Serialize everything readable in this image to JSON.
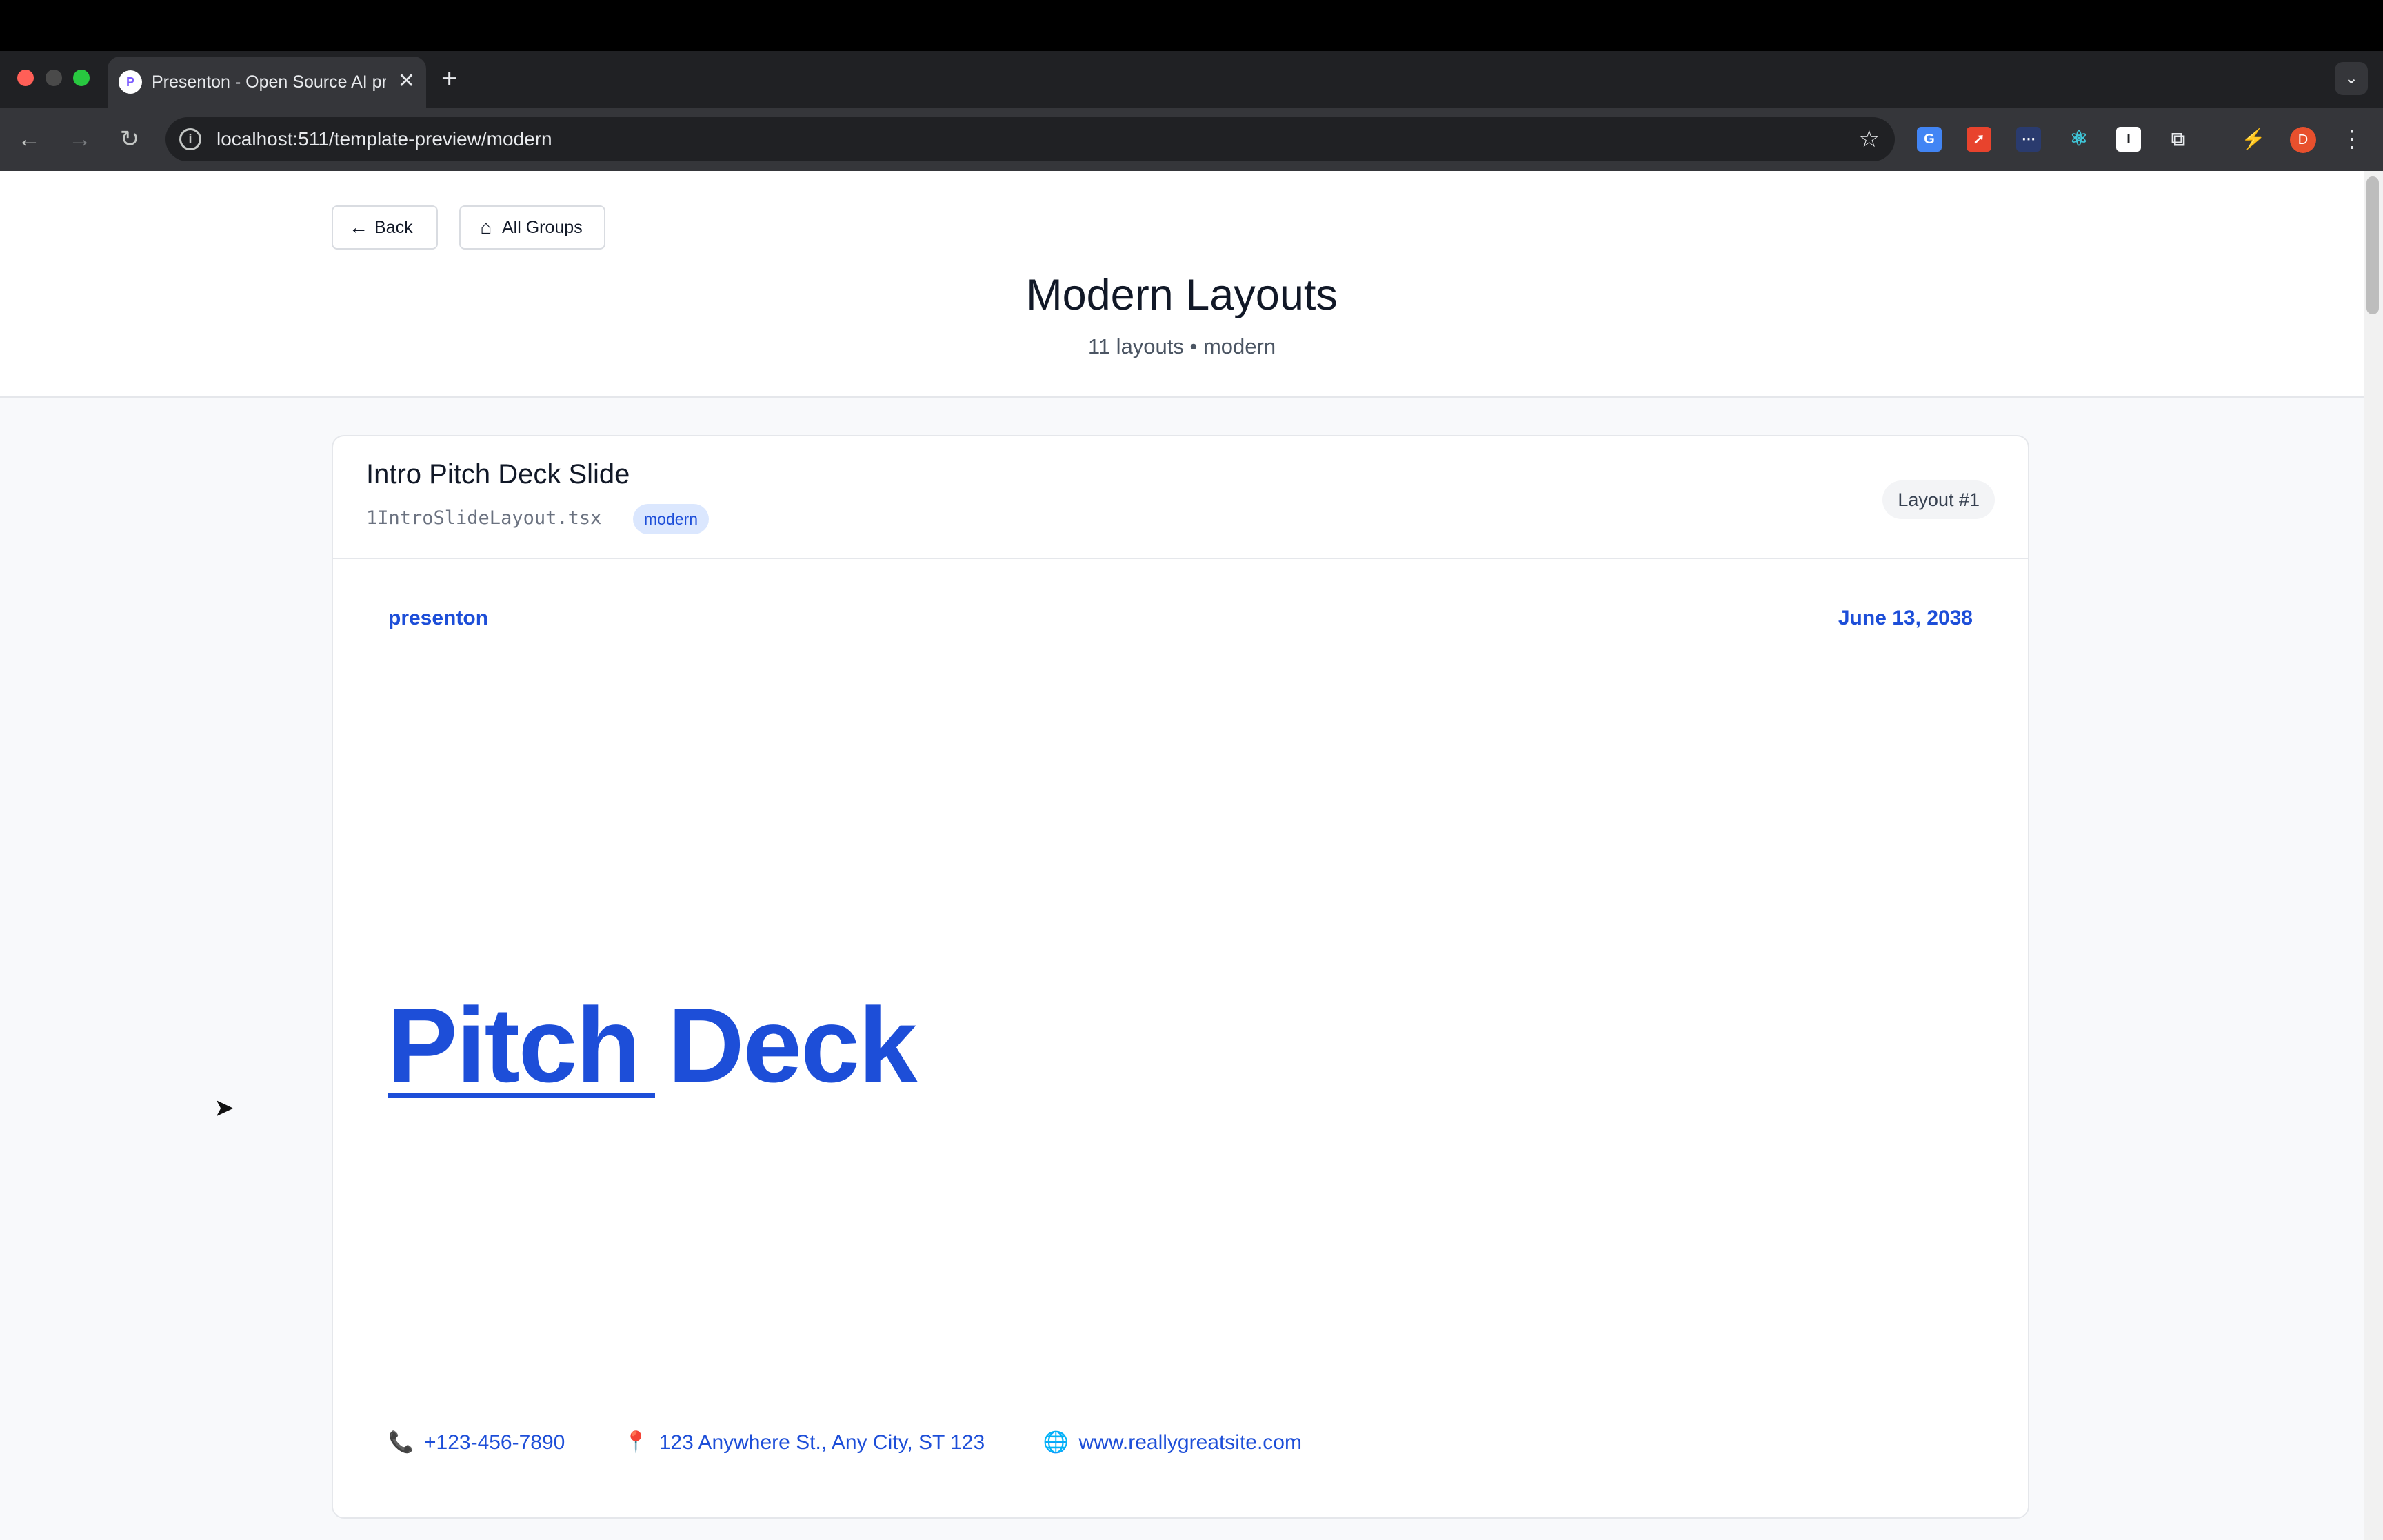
{
  "browser": {
    "tab_title": "Presenton - Open Source AI presentation generator",
    "tab_close": "✕",
    "new_tab": "+",
    "tab_menu": "⌄",
    "url": "localhost:511/template-preview/modern",
    "profile_initial": "D"
  },
  "header": {
    "back_label": "Back",
    "all_groups_label": "All Groups",
    "title": "Modern Layouts",
    "subtitle": "11 layouts • modern"
  },
  "card": {
    "layout_name": "Intro Pitch Deck Slide",
    "file_name": "1IntroSlideLayout.tsx",
    "tag": "modern",
    "layout_number": "Layout #1"
  },
  "slide": {
    "brand": "presenton",
    "date": "June 13, 2038",
    "heading_word1": "Pitch",
    "heading_word2": "Deck",
    "phone": "+123-456-7890",
    "address": "123 Anywhere St., Any City, ST 123",
    "website": "www.reallygreatsite.com",
    "accent_color": "#1d4ed8"
  },
  "icons": {
    "back": "arrow-left-icon",
    "home": "home-icon",
    "phone": "phone-icon",
    "pin": "map-pin-icon",
    "globe": "globe-icon"
  }
}
